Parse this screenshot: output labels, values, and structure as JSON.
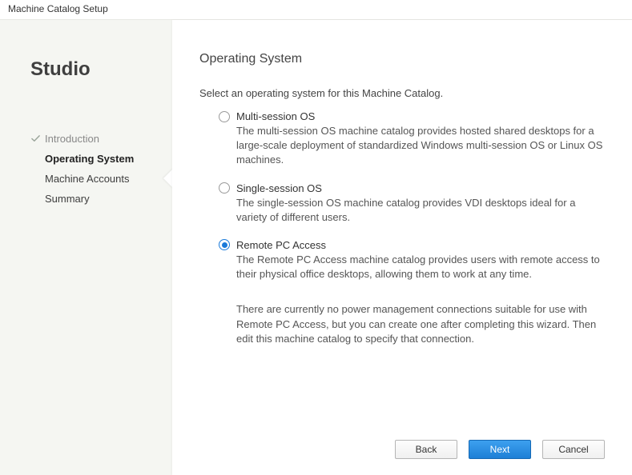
{
  "window": {
    "title": "Machine Catalog Setup"
  },
  "brand": "Studio",
  "nav": {
    "items": [
      {
        "label": "Introduction",
        "state": "completed"
      },
      {
        "label": "Operating System",
        "state": "current"
      },
      {
        "label": "Machine Accounts",
        "state": "pending"
      },
      {
        "label": "Summary",
        "state": "pending"
      }
    ]
  },
  "page": {
    "title": "Operating System",
    "instruction": "Select an operating system for this Machine Catalog.",
    "options": [
      {
        "label": "Multi-session OS",
        "description": "The multi-session OS machine catalog provides hosted shared desktops for a large-scale deployment of standardized Windows multi-session OS or Linux OS machines.",
        "selected": false
      },
      {
        "label": "Single-session OS",
        "description": "The single-session OS machine catalog provides VDI desktops ideal for a variety of different users.",
        "selected": false
      },
      {
        "label": "Remote PC Access",
        "description": "The Remote PC Access machine catalog provides users with remote access to their physical office desktops, allowing them to work at any time.",
        "selected": true
      }
    ],
    "note": "There are currently no power management connections suitable for use with Remote PC Access, but you can create one after completing this wizard. Then edit this machine catalog to specify that connection."
  },
  "buttons": {
    "back": "Back",
    "next": "Next",
    "cancel": "Cancel"
  }
}
